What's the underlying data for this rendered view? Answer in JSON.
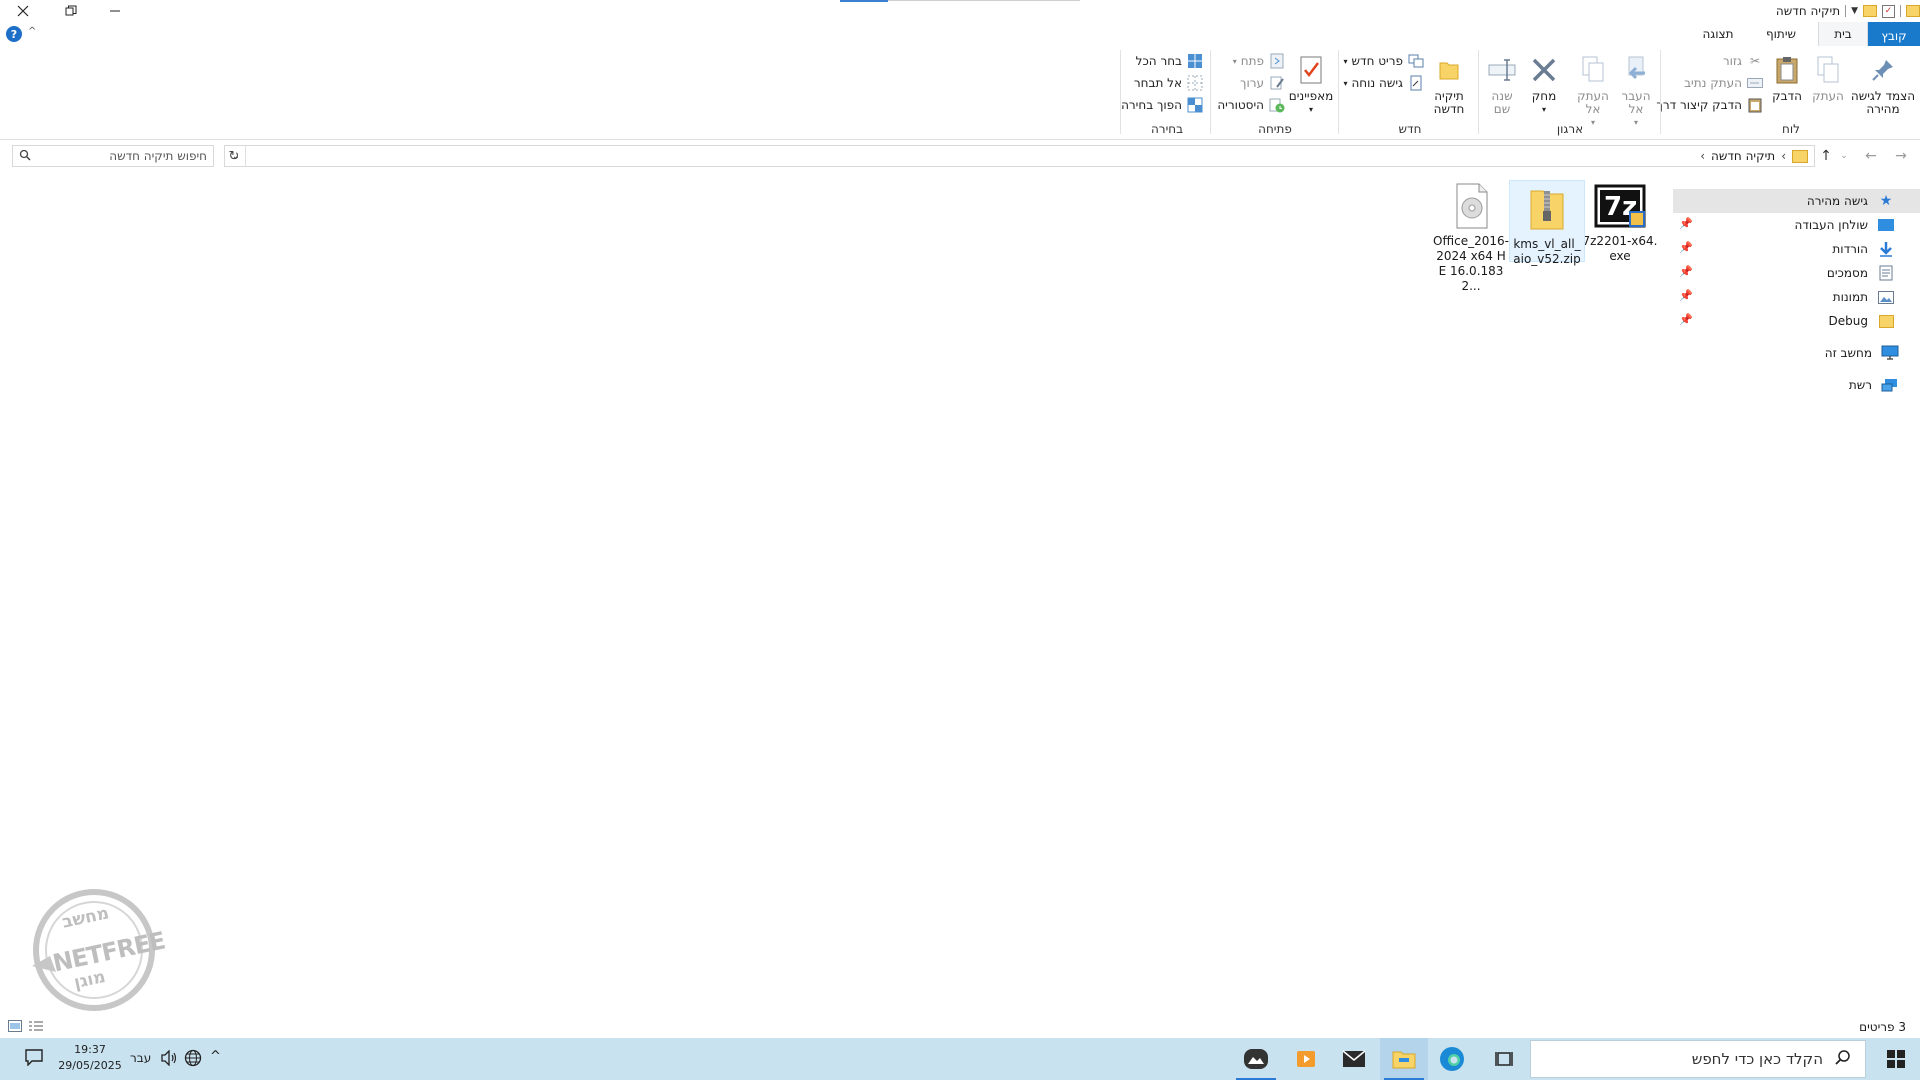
{
  "window": {
    "title": "תיקיה חדשה"
  },
  "tabs": {
    "file": "קובץ",
    "home": "בית",
    "share": "שיתוף",
    "view": "תצוגה"
  },
  "ribbon": {
    "clipboard": {
      "label": "לוח",
      "pin": "הצמד לגישה מהירה",
      "copy": "העתק",
      "paste": "הדבק",
      "cut": "גזור",
      "copy_path": "העתק נתיב",
      "paste_shortcut": "הדבק קיצור דרך"
    },
    "organize": {
      "label": "ארגון",
      "move_to": "העבר אל",
      "copy_to": "העתק אל",
      "delete": "מחק",
      "rename": "שנה שם"
    },
    "new": {
      "label": "חדש",
      "new_folder": "תיקיה חדשה",
      "new_item": "פריט חדש",
      "easy_access": "גישה נוחה"
    },
    "open": {
      "label": "פתיחה",
      "properties": "מאפיינים",
      "open": "פתח",
      "edit": "ערוך",
      "history": "היסטוריה"
    },
    "select": {
      "label": "בחירה",
      "select_all": "בחר הכל",
      "select_none": "אל תבחר",
      "invert": "הפוך בחירה"
    }
  },
  "address": {
    "crumb": "תיקיה חדשה",
    "search_placeholder": "חיפוש תיקיה חדשה"
  },
  "nav": {
    "quick_access": "גישה מהירה",
    "items": [
      {
        "label": "שולחן העבודה",
        "icon": "desktop-icon"
      },
      {
        "label": "הורדות",
        "icon": "downloads-icon"
      },
      {
        "label": "מסמכים",
        "icon": "documents-icon"
      },
      {
        "label": "תמונות",
        "icon": "pictures-icon"
      },
      {
        "label": "Debug",
        "icon": "folder-icon"
      }
    ],
    "this_pc": "מחשב זה",
    "network": "רשת"
  },
  "files": [
    {
      "name": "7z2201-x64.exe",
      "icon": "7zip-exe-icon"
    },
    {
      "name": "kms_vl_all_aio_v52.zip",
      "icon": "zip-folder-icon",
      "selected": true
    },
    {
      "name": "Office_2016-2024 x64 HE 16.0.1832...",
      "icon": "disc-image-icon"
    }
  ],
  "status": {
    "count": "3 פריטים"
  },
  "taskbar": {
    "search_placeholder": "הקלד כאן כדי לחפש",
    "lang": "עבר",
    "time": "19:37",
    "date": "29/05/2025"
  },
  "watermark": {
    "top_text": "מחשב",
    "brand": "NETFREE",
    "bottom_text": "מוגן"
  },
  "colors": {
    "accent": "#1979ca",
    "taskbar": "#c9e2f0",
    "selection": "#e5f3ff"
  }
}
